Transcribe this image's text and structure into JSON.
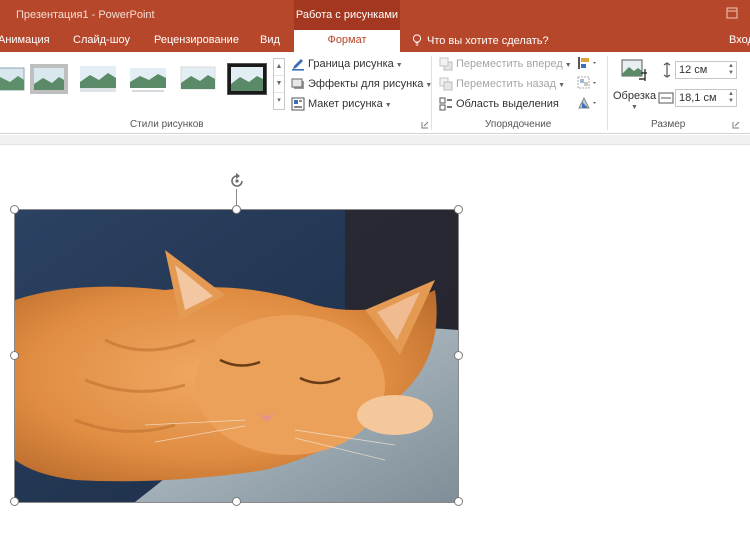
{
  "window": {
    "title": "Презентация1 - PowerPoint",
    "context_header": "Работа с рисунками"
  },
  "tabs": [
    {
      "label": "Анимация"
    },
    {
      "label": "Слайд-шоу"
    },
    {
      "label": "Рецензирование"
    },
    {
      "label": "Вид"
    },
    {
      "label": "Формат",
      "active": true
    },
    {
      "label": "Вход"
    }
  ],
  "tell_me": {
    "placeholder": "Что вы хотите сделать?"
  },
  "ribbon": {
    "styles_group": {
      "label": "Стили рисунков",
      "selected_style_index": 5
    },
    "picture_commands": {
      "border": "Граница рисунка",
      "effects": "Эффекты для рисунка",
      "layout": "Макет рисунка"
    },
    "arrange_group": {
      "label": "Упорядочение",
      "bring_forward": "Переместить вперед",
      "send_backward": "Переместить назад",
      "selection_pane": "Область выделения"
    },
    "size_group": {
      "label": "Размер",
      "crop": "Обрезка",
      "height_value": "12 см",
      "width_value": "18,1 см"
    }
  },
  "colors": {
    "accent": "#b7472a",
    "context_tab": "#a4371f",
    "ribbon_bg": "#ffffff"
  },
  "slide": {
    "picture": {
      "subject": "sleeping ginger cat on grey blanket"
    }
  }
}
